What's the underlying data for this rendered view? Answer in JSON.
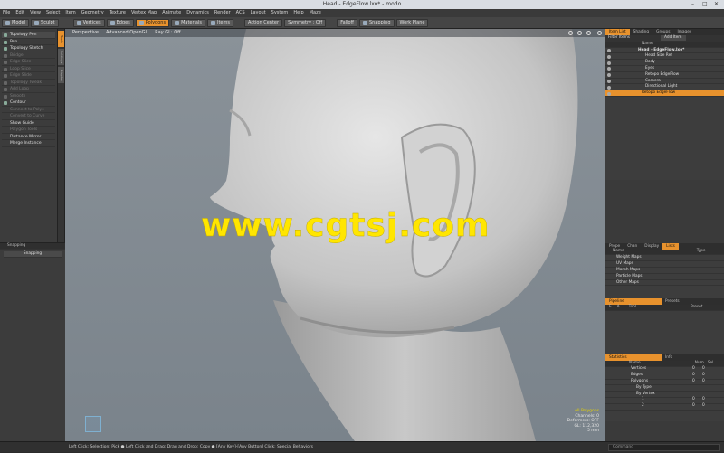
{
  "window": {
    "title": "Head - EdgeFlow.lxo* - modo"
  },
  "menu": [
    "File",
    "Edit",
    "View",
    "Select",
    "Item",
    "Geometry",
    "Texture",
    "Vertex Map",
    "Animate",
    "Dynamics",
    "Render",
    "ACS",
    "Layout",
    "System",
    "Help",
    "Maze"
  ],
  "toolbar": {
    "model": "Model",
    "sculpt": "Sculpt",
    "vertices": "Vertices",
    "edges": "Edges",
    "polygons": "Polygons",
    "materials": "Materials",
    "items": "Items",
    "action_center": "Action Center",
    "symmetry": "Symmetry : Off",
    "falloff": "Falloff",
    "snapping": "Snapping",
    "work_plane": "Work Plane"
  },
  "tools": [
    {
      "label": "Topology Pen",
      "dim": false,
      "sel": true
    },
    {
      "label": "Pen",
      "dim": false
    },
    {
      "label": "Topology Sketch",
      "dim": false
    },
    {
      "label": "Bridge",
      "dim": true
    },
    {
      "label": "Edge Slice",
      "dim": true
    },
    {
      "label": "Loop Slice",
      "dim": true
    },
    {
      "label": "Edge Slide",
      "dim": true
    },
    {
      "label": "Topology Tweak",
      "dim": true
    },
    {
      "label": "Add Loop",
      "dim": true
    },
    {
      "label": "Smooth",
      "dim": true
    },
    {
      "label": "Contour",
      "dim": false
    },
    {
      "label": "Connect to Polys",
      "dim": true
    },
    {
      "label": "Convert to Curve",
      "dim": true
    },
    {
      "label": "Show Guide",
      "dim": false
    },
    {
      "label": "Polygon Tools",
      "dim": true
    },
    {
      "label": "Distance Mirror",
      "dim": false
    },
    {
      "label": "Merge Instance",
      "dim": false
    }
  ],
  "vtabs": [
    "Tools",
    "Settings",
    "Display"
  ],
  "snapping": {
    "title": "Snapping",
    "toggle": "Snapping"
  },
  "viewport": {
    "view": "Perspective",
    "shading": "Advanced OpenGL",
    "ray": "Ray GL: Off"
  },
  "watermark": "www.cgtsj.com",
  "stats": {
    "mode": "All Polygons",
    "channels": "Channels: 0",
    "deformers": "Deformers: OFF",
    "gl": "GL: 112,320",
    "unit": "5 mm"
  },
  "items": {
    "tabs": [
      "Item List",
      "Shading",
      "Groups",
      "Images"
    ],
    "filter": "Filter Items",
    "add": "Add Item",
    "header": "Name",
    "rows": [
      {
        "label": "Head - EdgeFlow.lxo*",
        "indent": 0
      },
      {
        "label": "Head Size Ref",
        "indent": 1
      },
      {
        "label": "Body",
        "indent": 1
      },
      {
        "label": "Eyes",
        "indent": 1
      },
      {
        "label": "Retopo EdgeFlow",
        "indent": 1
      },
      {
        "label": "Camera",
        "indent": 1
      },
      {
        "label": "Directional Light",
        "indent": 1
      },
      {
        "label": "Retopo EdgeFlow",
        "indent": 1,
        "sel": true
      }
    ]
  },
  "lists": {
    "tabs": [
      "Prope",
      "Chan",
      "Display",
      "Lists"
    ],
    "header_name": "Name",
    "header_type": "Type",
    "rows": [
      "Weight Maps",
      "UV Maps",
      "Morph Maps",
      "Particle Maps",
      "Other Maps"
    ]
  },
  "pipeline": {
    "tabs": [
      "Pipeline",
      "Presets"
    ],
    "cols": [
      "E",
      "A",
      "Tool",
      "Preset"
    ]
  },
  "statistics": {
    "tabs": [
      "Statistics",
      "Info"
    ],
    "cols": [
      "Name",
      "Num",
      "Sel"
    ],
    "rows": [
      {
        "label": "Vertices",
        "num": "0",
        "sel": "0"
      },
      {
        "label": "Edges",
        "num": "0",
        "sel": "0"
      },
      {
        "label": "Polygons",
        "num": "0",
        "sel": "0"
      },
      {
        "label": "By Type",
        "num": "",
        "sel": ""
      },
      {
        "label": "By Vertex",
        "num": "",
        "sel": ""
      },
      {
        "label": "1",
        "num": "0",
        "sel": "0"
      },
      {
        "label": "2",
        "num": "0",
        "sel": "0"
      }
    ]
  },
  "status": "Left Click: Selection: Pick ● Left Click and Drag: Drag and Drop: Copy ● [Any Key]-[Any Button] Click: Special Behaviors",
  "command": "Command"
}
